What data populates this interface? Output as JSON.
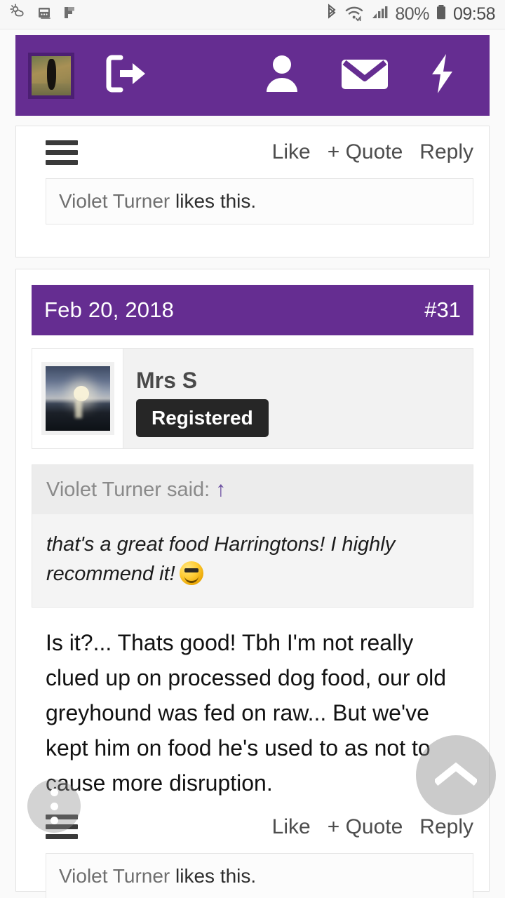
{
  "status_bar": {
    "icons_left": [
      "weather-icon",
      "calendar-icon",
      "flag-icon"
    ],
    "icons_right": [
      "bluetooth-icon",
      "wifi-icon",
      "signal-icon",
      "battery-icon"
    ],
    "battery_percent": "80%",
    "clock": "09:58"
  },
  "navbar": {
    "avatar_alt": "user-avatar-dog-photo",
    "icons": [
      "logout-icon",
      "person-icon",
      "mail-icon",
      "bolt-icon"
    ],
    "background_color": "#652D91"
  },
  "post_top": {
    "menu_icon": "hamburger-icon",
    "actions": {
      "like": "Like",
      "quote": "+ Quote",
      "reply": "Reply"
    },
    "likes": {
      "liker": "Violet Turner",
      "suffix": " likes this."
    }
  },
  "post_main": {
    "header": {
      "date": "Feb 20, 2018",
      "number": "#31"
    },
    "user": {
      "name": "Mrs S",
      "badge": "Registered",
      "avatar_alt": "user-avatar-sunset-beach"
    },
    "quote": {
      "attribution": "Violet Turner said:",
      "jump_arrow": "↑",
      "text": "that's a great food Harringtons! I highly recommend it!",
      "emoji": "smiley-emoji"
    },
    "body": "Is it?... Thats good! Tbh I'm not really clued up on processed dog food, our old greyhound was fed on raw... But we've kept him on food he's used to as not to cause more disruption.",
    "menu_icon": "hamburger-icon",
    "actions": {
      "like": "Like",
      "quote": "+ Quote",
      "reply": "Reply"
    },
    "likes": {
      "liker": "Violet Turner",
      "suffix": " likes this."
    }
  },
  "floating_buttons": {
    "scroll_top": "chevron-up-icon",
    "overflow_menu": "three-dots-icon"
  }
}
